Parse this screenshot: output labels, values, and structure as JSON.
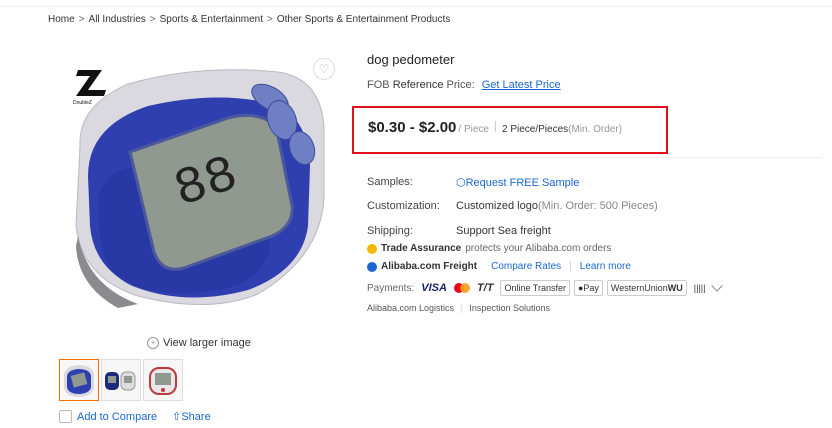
{
  "breadcrumb": [
    "Home",
    "All Industries",
    "Sports & Entertainment",
    "Other Sports & Entertainment Products"
  ],
  "product": {
    "title": "dog pedometer",
    "fob_prefix": "FOB",
    "fob_bold": "Reference",
    "fob_suffix": "Price:",
    "fob_link": "Get Latest Price",
    "price": "$0.30 - $2.00",
    "unit": "/ Piece",
    "moq_value": "2 Piece/Pieces",
    "moq_note": "(Min. Order)"
  },
  "gallery": {
    "brand_logo_text": "DoubleZ",
    "view_larger": "View larger image",
    "add_to_compare": "Add to Compare",
    "share": "Share",
    "thumb_count": 3
  },
  "details": {
    "samples_label": "Samples:",
    "samples_value": "Request FREE Sample",
    "customization_label": "Customization:",
    "customization_value": "Customized logo",
    "customization_note": "(Min. Order: 500 Pieces)",
    "shipping_label": "Shipping:",
    "shipping_value": "Support Sea freight"
  },
  "trade": {
    "title": "Trade Assurance",
    "desc": "protects your Alibaba.com orders"
  },
  "freight": {
    "title": "Alibaba.com Freight",
    "compare": "Compare Rates",
    "learn": "Learn more"
  },
  "payments": {
    "label": "Payments:",
    "visa": "VISA",
    "tt": "T/T",
    "online": "Online Transfer",
    "applepay": "Pay",
    "wu": "WesternUnion",
    "wu_suffix": "WU"
  },
  "logistics": {
    "a": "Alibaba.com Logistics",
    "b": "Inspection Solutions"
  },
  "colors": {
    "accent": "#1a66d2",
    "highlight_border": "#e0111a",
    "active_thumb": "#ff6a00",
    "product_blue": "#2f3fb0"
  }
}
